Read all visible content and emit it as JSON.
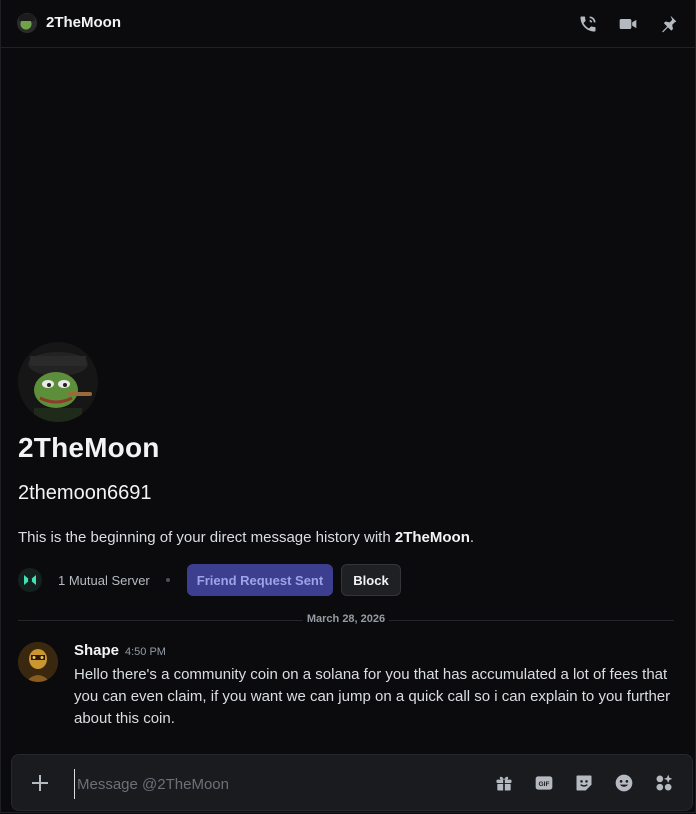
{
  "header": {
    "title": "2TheMoon",
    "icons": [
      "phone-call-icon",
      "video-camera-icon",
      "pin-icon"
    ]
  },
  "intro": {
    "display_name": "2TheMoon",
    "username": "2themoon6691",
    "description_prefix": "This is the beginning of your direct message history with ",
    "description_name": "2TheMoon",
    "description_suffix": ".",
    "mutual_servers": "1 Mutual Server",
    "friend_request_label": "Friend Request Sent",
    "block_label": "Block"
  },
  "divider": {
    "date": "March 28, 2026"
  },
  "message": {
    "author": "Shape",
    "time": "4:50 PM",
    "content": "Hello there's a community coin on a solana for you that has accumulated a lot of fees that you can even claim, if you want we can jump on a quick call so i can explain to you further about this coin."
  },
  "composer": {
    "placeholder": "Message @2TheMoon",
    "icons": [
      "gift-icon",
      "gif-icon",
      "sticker-icon",
      "emoji-icon",
      "apps-icon"
    ]
  },
  "colors": {
    "background": "#0b0b0d",
    "friend_button": "#3c3f8f",
    "friend_button_text": "#9ea3e8",
    "text_primary": "#f2f3f5",
    "text_muted": "#949ba4"
  }
}
